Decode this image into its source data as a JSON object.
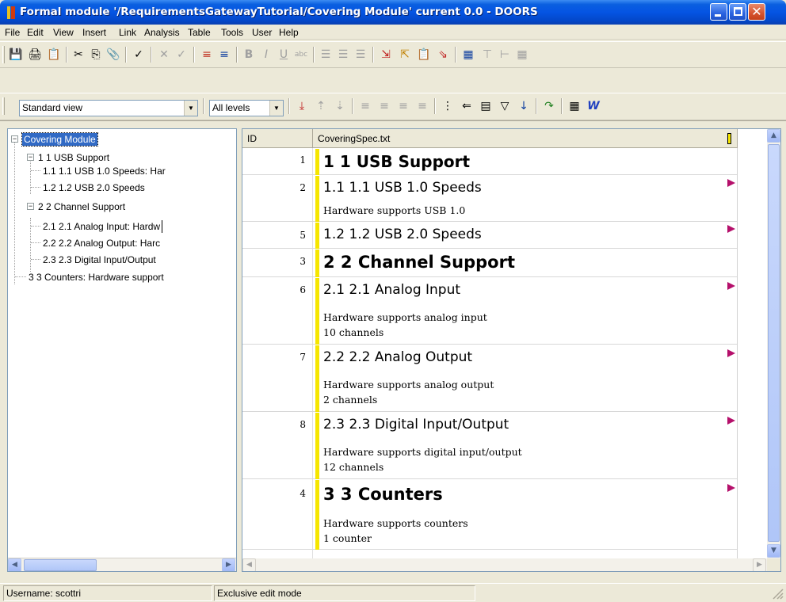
{
  "window": {
    "title": "Formal module '/RequirementsGatewayTutorial/Covering Module' current 0.0 - DOORS",
    "close_glyph": "✕"
  },
  "menu": [
    "File",
    "Edit",
    "View",
    "Insert",
    "Link",
    "Analysis",
    "Table",
    "Tools",
    "User",
    "Help"
  ],
  "toolbar": {
    "view_selector": "Standard view",
    "levels_selector": "All levels"
  },
  "tree": {
    "root": "Covering Module",
    "items": [
      {
        "label": "1 1 USB Support"
      },
      {
        "label": "1.1 1.1 USB 1.0 Speeds: Har"
      },
      {
        "label": "1.2 1.2 USB 2.0 Speeds"
      },
      {
        "label": "2 2 Channel Support"
      },
      {
        "label": "2.1 2.1 Analog Input: Hardw"
      },
      {
        "label": "2.2 2.2 Analog Output: Harc"
      },
      {
        "label": "2.3 2.3 Digital Input/Output"
      },
      {
        "label": "3 3 Counters: Hardware support"
      }
    ]
  },
  "columns": {
    "id": "ID",
    "main": "CoveringSpec.txt"
  },
  "rows": [
    {
      "id": "1",
      "heading": "1 1 USB Support",
      "lines": []
    },
    {
      "id": "2",
      "heading": "1.1 1.1 USB 1.0 Speeds",
      "lines": [
        "Hardware supports USB 1.0"
      ]
    },
    {
      "id": "5",
      "heading": "1.2 1.2 USB 2.0 Speeds",
      "lines": []
    },
    {
      "id": "3",
      "heading": "2 2 Channel Support",
      "lines": []
    },
    {
      "id": "6",
      "heading": "2.1 2.1 Analog Input",
      "lines": [
        "Hardware supports analog input",
        "10 channels"
      ]
    },
    {
      "id": "7",
      "heading": "2.2 2.2 Analog Output",
      "lines": [
        "Hardware supports analog output",
        "2 channels"
      ]
    },
    {
      "id": "8",
      "heading": "2.3 2.3 Digital Input/Output",
      "lines": [
        "Hardware supports digital input/output",
        "12 channels"
      ]
    },
    {
      "id": "4",
      "heading": "3 3 Counters",
      "lines": [
        "Hardware supports counters",
        "1 counter"
      ]
    }
  ],
  "status": {
    "user": "Username: scottri",
    "mode": "Exclusive edit mode"
  },
  "colors": {
    "title_bar": "#0554e3",
    "selection": "#316ac5",
    "change_bar": "#f6e600",
    "link_marker": "#b5106b"
  }
}
